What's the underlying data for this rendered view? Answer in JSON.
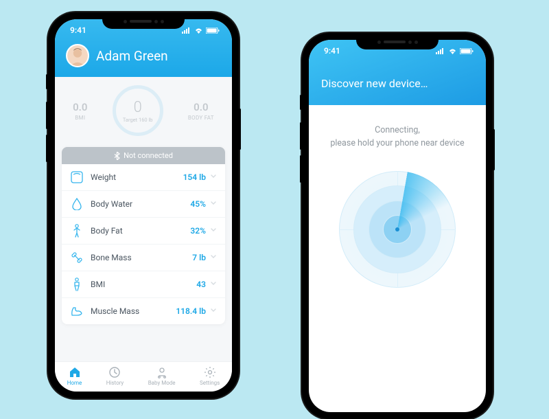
{
  "status": {
    "time": "9:41"
  },
  "phoneA": {
    "user": {
      "name": "Adam Green"
    },
    "summary": {
      "bmi": {
        "value": "0.0",
        "label": "BMI"
      },
      "target": {
        "value": "0",
        "label": "Target 160 lb"
      },
      "bodyfat": {
        "value": "0.0",
        "label": "BODY FAT"
      }
    },
    "connection": {
      "status": "Not connected"
    },
    "metrics": [
      {
        "name": "Weight",
        "value": "154 lb",
        "icon": "scale-icon"
      },
      {
        "name": "Body Water",
        "value": "45%",
        "icon": "water-icon"
      },
      {
        "name": "Body Fat",
        "value": "32%",
        "icon": "bodyfat-icon"
      },
      {
        "name": "Bone Mass",
        "value": "7 lb",
        "icon": "bone-icon"
      },
      {
        "name": "BMI",
        "value": "43",
        "icon": "bmi-icon"
      },
      {
        "name": "Muscle Mass",
        "value": "118.4 lb",
        "icon": "muscle-icon"
      }
    ],
    "tabs": [
      {
        "label": "Home",
        "icon": "home-icon",
        "active": true
      },
      {
        "label": "History",
        "icon": "history-icon",
        "active": false
      },
      {
        "label": "Baby Mode",
        "icon": "baby-icon",
        "active": false
      },
      {
        "label": "Settings",
        "icon": "settings-icon",
        "active": false
      }
    ]
  },
  "phoneB": {
    "title": "Discover new device…",
    "message_line1": "Connecting,",
    "message_line2": "please hold your phone near device"
  }
}
